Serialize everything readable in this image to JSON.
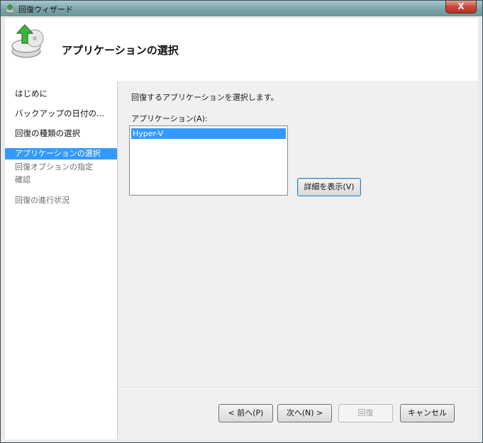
{
  "window": {
    "title": "回復ウィザード",
    "close_label": "X"
  },
  "header": {
    "title": "アプリケーションの選択"
  },
  "sidebar": {
    "items": [
      {
        "label": "はじめに",
        "state": "normal"
      },
      {
        "label": "バックアップの日付の...",
        "state": "normal"
      },
      {
        "label": "回復の種類の選択",
        "state": "normal"
      },
      {
        "label": "アプリケーションの選択",
        "state": "active"
      },
      {
        "label": "回復オプションの指定",
        "state": "dim"
      },
      {
        "label": "確認",
        "state": "dim"
      },
      {
        "label": "回復の進行状況",
        "state": "dim"
      }
    ]
  },
  "main": {
    "description": "回復するアプリケーションを選択します。",
    "list_label": "アプリケーション(A):",
    "applications": [
      "Hyper-V"
    ],
    "details_button": "詳細を表示(V)"
  },
  "footer": {
    "back_label": "< 前へ(P)",
    "next_label": "次へ(N) >",
    "recover_label": "回復",
    "cancel_label": "キャンセル"
  },
  "colors": {
    "selection": "#3399ff",
    "titlebar": "#7aa4a8",
    "close": "#c9483a"
  }
}
